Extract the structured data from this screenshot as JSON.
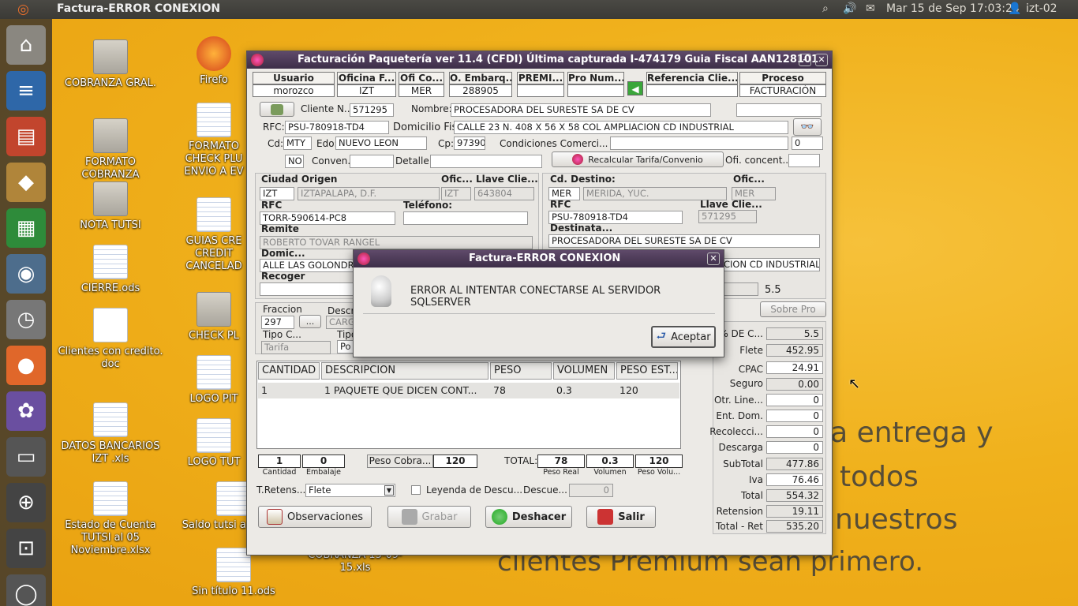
{
  "topbar": {
    "window_title": "Factura-ERROR CONEXION",
    "datetime": "Mar 15 de Sep 17:03:24",
    "user": "izt-02"
  },
  "wallpaper": {
    "line1": "ta entrega y",
    "line2": "todos",
    "line3": "nuestros",
    "line4": "clientes Premium sean primero."
  },
  "desktop": {
    "icons": [
      "COBRANZA GRAL.",
      "Firefo",
      "FORMATO COBRANZA",
      "FORMATO CHECK PLU ENVIO A EV",
      "NOTA TUTSI",
      "GUIAS CRE CREDIT CANCELAD",
      "CIERRE.ods",
      "CHECK PL",
      "Clientes con credito. doc",
      "LOGO PIT",
      "DATOS BANCARIOS IZT .xls",
      "LOGO TUT",
      "Estado de Cuenta TUTSI al 05 Noviembre.xlsx",
      "Saldo tutsi a sep.xls",
      "COBRANZA 15-09-15.xls",
      "Sin título 11.ods"
    ]
  },
  "app": {
    "title": "Facturación Paquetería ver 11.4 (CFDI)  Última capturada I-474179 Guia Fiscal AAN128101",
    "header": [
      {
        "h": "Usuario",
        "v": "morozco"
      },
      {
        "h": "Oficina F...",
        "v": "IZT"
      },
      {
        "h": "Ofi Co...",
        "v": "MER"
      },
      {
        "h": "O. Embarq...",
        "v": "288905"
      },
      {
        "h": "PREMI...",
        "v": ""
      },
      {
        "h": "Pro Num...",
        "v": ""
      },
      {
        "h": "Referencia Clie...",
        "v": ""
      },
      {
        "h": "Proceso",
        "v": "FACTURACIÓN"
      }
    ],
    "cliente": {
      "cliente_label": "Cliente N...",
      "cliente_num": "571295",
      "nombre_label": "Nombre:",
      "nombre": "PROCESADORA DEL SURESTE SA DE CV",
      "rfc_label": "RFC:",
      "rfc": "PSU-780918-TD4",
      "dom_label": "Domicilio Fis",
      "domicilio": "CALLE 23 N. 408 X 56 X 58 COL AMPLIACION CD INDUSTRIAL",
      "cd_label": "Cd:",
      "cd": "MTY",
      "edo_label": "Edo:",
      "edo": "NUEVO LEON",
      "cp_label": "Cp:",
      "cp": "97390",
      "cond_label": "Condiciones Comerci...",
      "cond_num": "0",
      "no": "NO",
      "conven_label": "Conven.",
      "detalle_label": "Detalle",
      "recalc_label": "Recalcular Tarifa/Convenio",
      "oficon_label": "Ofi. concent..."
    },
    "origen": {
      "ciudad_label": "Ciudad Origen",
      "ofic_label": "Ofic...",
      "llave_label": "Llave Clie...",
      "ciudad_code": "IZT",
      "ciudad": "IZTAPALAPA, D.F.",
      "ofic": "IZT",
      "llave": "643804",
      "rfc_label": "RFC",
      "rfc": "TORR-590614-PC8",
      "tel_label": "Teléfono:",
      "remite_label": "Remite",
      "remite": "ROBERTO TOVAR RANGEL",
      "domic_label": "Domic...",
      "domic": "ALLE LAS GOLONDRINAS",
      "recoger_label": "Recoger"
    },
    "destino": {
      "cd_label": "Cd. Destino:",
      "ofic_label": "Ofic...",
      "cd_code": "MER",
      "cd": "MERIDA, YUC.",
      "ofic": "MER",
      "rfc_label": "RFC",
      "llave_label": "Llave Clie...",
      "rfc": "PSU-780918-TD4",
      "llave": "571295",
      "dest_label": "Destinata...",
      "destinatario": "PROCESADORA DEL SURESTE SA DE CV",
      "dom": "CION CD INDUSTRIAL",
      "pct": "5.5",
      "sobre_pro": "Sobre Pro"
    },
    "fraccion": {
      "label": "Fraccion",
      "value": "297",
      "desc_label": "Descr",
      "desc": "CARGA",
      "tipoc_label": "Tipo C...",
      "tipo_label": "Tipo",
      "tarifa": "Tarifa",
      "po": "Po"
    },
    "table": {
      "columns": [
        "CANTIDAD",
        "DESCRIPCION",
        "PESO",
        "VOLUMEN",
        "PESO EST..."
      ],
      "rows": [
        [
          "1",
          "1  PAQUETE  QUE DICEN CONT...",
          "78",
          "0.3",
          "120"
        ]
      ]
    },
    "summary": {
      "cantidad": "1",
      "embalaje": "0",
      "cantidad_label": "Cantidad",
      "embalaje_label": "Embalaje",
      "peso_cobra_label": "Peso Cobra...",
      "peso_cobra": "120",
      "total_label": "TOTAL:",
      "peso_real": "78",
      "volumen": "0.3",
      "peso_vol": "120",
      "peso_real_label": "Peso Real",
      "volumen_label": "Volumen",
      "peso_vol_label": "Peso Volu...",
      "tretens_label": "T.Retens...",
      "tretens": "Flete",
      "leyenda_label": "Leyenda de Descu...",
      "descue_label": "Descue...",
      "descue": "0"
    },
    "buttons": {
      "observaciones": "Observaciones",
      "grabar": "Grabar",
      "deshacer": "Deshacer",
      "salir": "Salir"
    },
    "totals": [
      {
        "l": "% DE C...",
        "v": "5.5"
      },
      {
        "l": "Flete",
        "v": "452.95"
      },
      {
        "l": "CPAC",
        "v": "24.91"
      },
      {
        "l": "Seguro",
        "v": "0.00"
      },
      {
        "l": "Otr. Line...",
        "v": "0"
      },
      {
        "l": "Ent. Dom.",
        "v": "0"
      },
      {
        "l": "Recolecci...",
        "v": "0"
      },
      {
        "l": "Descarga",
        "v": "0"
      },
      {
        "l": "SubTotal",
        "v": "477.86"
      },
      {
        "l": "Iva",
        "v": "76.46"
      },
      {
        "l": "Total",
        "v": "554.32"
      },
      {
        "l": "Retension",
        "v": "19.11"
      },
      {
        "l": "Total - Ret",
        "v": "535.20"
      }
    ]
  },
  "dialog": {
    "title": "Factura-ERROR CONEXION",
    "message": "ERROR AL INTENTAR CONECTARSE AL SERVIDOR SQLSERVER",
    "button": "Aceptar"
  },
  "colors": {
    "accent": "#5f4a6a",
    "wallpaper": "#f0b11c"
  }
}
